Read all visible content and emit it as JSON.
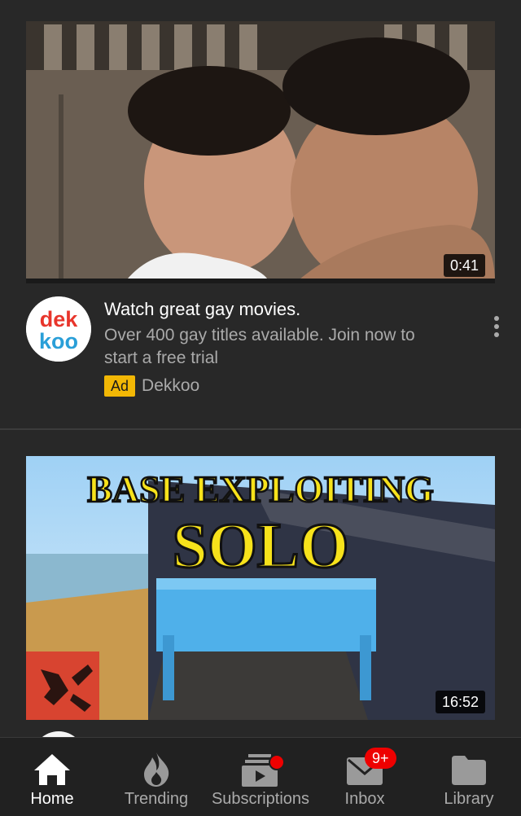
{
  "feed": {
    "ad_card": {
      "duration": "0:41",
      "avatar_text_top": "dek",
      "avatar_text_bottom": "koo",
      "title": "Watch great gay movies.",
      "description": "Over 400 gay titles available. Join now to start a free trial",
      "ad_label": "Ad",
      "channel": "Dekkoo"
    },
    "video_card": {
      "duration": "16:52",
      "thumb_line1": "BASE EXPLOITING",
      "thumb_line2": "SOLO"
    }
  },
  "navbar": {
    "items": [
      {
        "label": "Home",
        "icon": "home-icon"
      },
      {
        "label": "Trending",
        "icon": "flame-icon"
      },
      {
        "label": "Subscriptions",
        "icon": "subscriptions-icon"
      },
      {
        "label": "Inbox",
        "icon": "inbox-icon",
        "badge": "9+"
      },
      {
        "label": "Library",
        "icon": "folder-icon"
      }
    ]
  },
  "colors": {
    "background": "#282828",
    "ad_badge": "#f2b705",
    "notification_red": "#ee0000",
    "dekkoo_red": "#e8352b",
    "dekkoo_blue": "#2a9fd8"
  }
}
